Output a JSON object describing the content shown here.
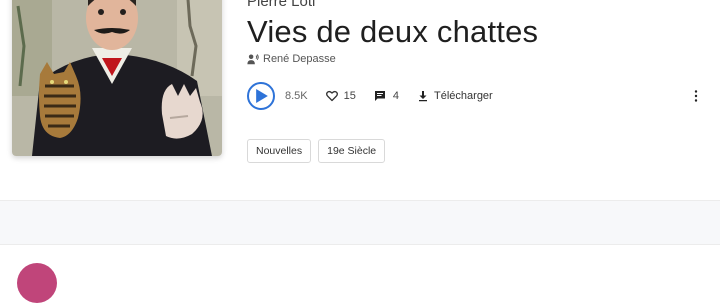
{
  "book": {
    "author": "Pierre Loti",
    "title": "Vies de deux chattes",
    "narrator": "René Depasse"
  },
  "stats": {
    "plays": "8.5K",
    "likes": "15",
    "comments": "4"
  },
  "actions": {
    "download_label": "Télécharger"
  },
  "tags": [
    "Nouvelles",
    "19e Siècle"
  ],
  "icons": {
    "play": "play-icon",
    "heart": "heart-icon",
    "comment": "comment-icon",
    "download": "download-icon",
    "more": "more-vertical-icon",
    "narrator": "voice-icon"
  },
  "colors": {
    "accent": "#2e73d8",
    "avatar": "#c0457a"
  }
}
